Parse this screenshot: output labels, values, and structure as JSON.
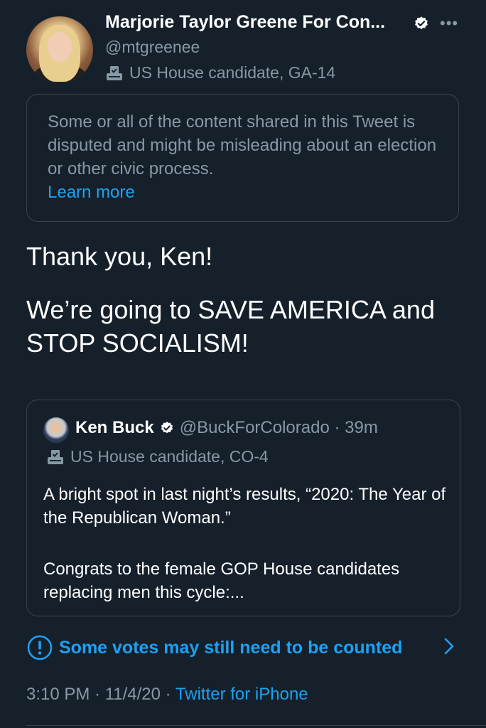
{
  "author": {
    "name": "Marjorie Taylor Greene For Con...",
    "handle": "@mtgreenee",
    "label": "US House candidate, GA-14",
    "verified_icon": "verified-badge-icon",
    "label_icon": "ballot-box-icon"
  },
  "notice": {
    "text": "Some or all of the content shared in this Tweet is disputed and might be misleading about an election or other civic process.",
    "link": "Learn more"
  },
  "tweet": {
    "line1": "Thank you, Ken!",
    "line2": "We’re going to SAVE AMERICA and STOP SOCIALISM!"
  },
  "quoted": {
    "name": "Ken Buck",
    "handle_time": "@BuckForColorado · 39m",
    "label": "US House candidate, CO-4",
    "text1": "A bright spot in last night’s results, “2020: The Year of the Republican Woman.”",
    "text2": "Congrats to the female GOP House candidates replacing men this cycle:..."
  },
  "votes_notice": {
    "text": "Some votes may still need to be counted",
    "icon": "info-exclamation-icon"
  },
  "meta": {
    "time_date": "3:10 PM · 11/4/20 · ",
    "source": "Twitter for iPhone"
  },
  "colors": {
    "background": "#15202b",
    "accent": "#1da1f2",
    "secondary_text": "#8899a6",
    "border": "#38444d"
  }
}
